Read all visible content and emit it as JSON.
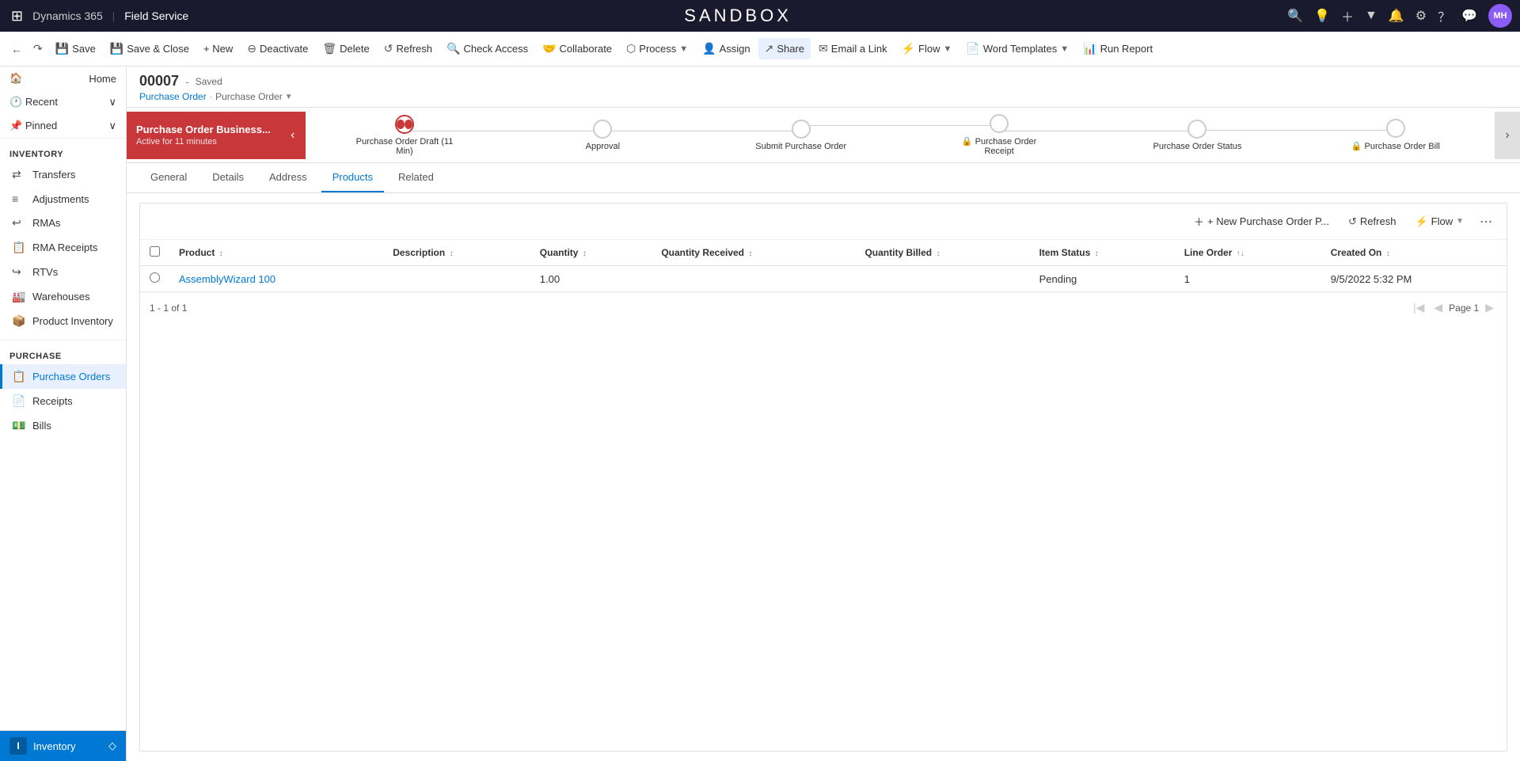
{
  "app": {
    "waffle": "⊞",
    "brand": "Dynamics 365",
    "separator": "|",
    "app_name": "Field Service",
    "sandbox_title": "SANDBOX"
  },
  "top_nav_icons": {
    "search": "🔍",
    "lightbulb": "💡",
    "plus": "+",
    "filter": "▼",
    "bell": "🔔",
    "gear": "⚙",
    "question": "?",
    "chat": "💬"
  },
  "avatar": {
    "initials": "MH"
  },
  "command_bar": {
    "back_icon": "←",
    "redo_icon": "↷",
    "save": "Save",
    "save_close": "Save & Close",
    "new": "+ New",
    "deactivate": "Deactivate",
    "delete": "Delete",
    "refresh": "Refresh",
    "check_access": "Check Access",
    "collaborate": "Collaborate",
    "process": "Process",
    "assign": "Assign",
    "share": "Share",
    "email_link": "Email a Link",
    "flow": "Flow",
    "word_templates": "Word Templates",
    "run_report": "Run Report"
  },
  "record": {
    "id": "00007",
    "status": "Saved",
    "breadcrumb_entity": "Purchase Order",
    "breadcrumb_separator": "·",
    "breadcrumb_type": "Purchase Order"
  },
  "process_steps": [
    {
      "label": "Purchase Order Draft  (11 Min)",
      "state": "active"
    },
    {
      "label": "Approval",
      "state": "inactive"
    },
    {
      "label": "Submit Purchase Order",
      "state": "inactive"
    },
    {
      "label": "Purchase Order Receipt",
      "state": "locked"
    },
    {
      "label": "Purchase Order Status",
      "state": "inactive"
    },
    {
      "label": "Purchase Order Bill",
      "state": "locked"
    }
  ],
  "active_stage": {
    "name": "Purchase Order Business...",
    "time": "Active for 11 minutes"
  },
  "tabs": [
    {
      "label": "General",
      "active": false
    },
    {
      "label": "Details",
      "active": false
    },
    {
      "label": "Address",
      "active": false
    },
    {
      "label": "Products",
      "active": true
    },
    {
      "label": "Related",
      "active": false
    }
  ],
  "subgrid": {
    "new_btn": "+ New Purchase Order P...",
    "refresh_btn": "Refresh",
    "flow_btn": "Flow",
    "more_icon": "⋯",
    "columns": [
      {
        "label": "Product",
        "sort": "↕"
      },
      {
        "label": "Description",
        "sort": "↕"
      },
      {
        "label": "Quantity",
        "sort": "↕"
      },
      {
        "label": "Quantity Received",
        "sort": "↕"
      },
      {
        "label": "Quantity Billed",
        "sort": "↕"
      },
      {
        "label": "Item Status",
        "sort": "↕"
      },
      {
        "label": "Line Order",
        "sort": "↑↓"
      },
      {
        "label": "Created On",
        "sort": "↕"
      }
    ],
    "rows": [
      {
        "product": "AssemblyWizard 100",
        "description": "",
        "quantity": "1.00",
        "quantity_received": "",
        "quantity_billed": "",
        "item_status": "Pending",
        "line_order": "1",
        "created_on": "9/5/2022 5:32 PM"
      }
    ],
    "footer_count": "1 - 1 of 1",
    "page_label": "Page 1"
  },
  "sidebar": {
    "home": "Home",
    "recent": "Recent",
    "pinned": "Pinned",
    "inventory_section": "Inventory",
    "inventory_items": [
      {
        "label": "Transfers",
        "icon": "⇄"
      },
      {
        "label": "Adjustments",
        "icon": "≡"
      },
      {
        "label": "RMAs",
        "icon": "↩"
      },
      {
        "label": "RMA Receipts",
        "icon": "📋"
      },
      {
        "label": "RTVs",
        "icon": "↪"
      },
      {
        "label": "Warehouses",
        "icon": "🏭"
      },
      {
        "label": "Product Inventory",
        "icon": "📦"
      }
    ],
    "purchase_section": "Purchase",
    "purchase_items": [
      {
        "label": "Purchase Orders",
        "icon": "📋",
        "active": true
      },
      {
        "label": "Receipts",
        "icon": "📄"
      },
      {
        "label": "Bills",
        "icon": "💵"
      }
    ],
    "bottom_label": "Inventory",
    "bottom_icon": "I"
  }
}
